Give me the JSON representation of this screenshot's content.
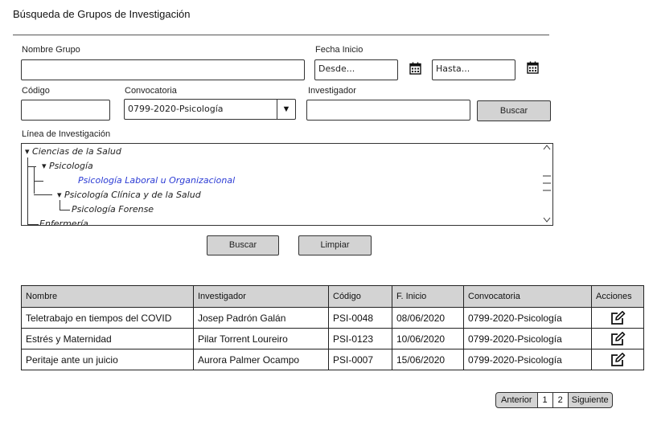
{
  "page_title": "Búsqueda de Grupos de Investigación",
  "filters": {
    "nombre_grupo_label": "Nombre Grupo",
    "nombre_grupo_value": "",
    "fecha_inicio_label": "Fecha Inicio",
    "desde_placeholder": "Desde...",
    "hasta_placeholder": "Hasta...",
    "codigo_label": "Código",
    "codigo_value": "",
    "convocatoria_label": "Convocatoria",
    "convocatoria_selected": "0799-2020-Psicología",
    "investigador_label": "Investigador",
    "investigador_value": "",
    "buscar_inline": "Buscar",
    "linea_label": "Línea de Investigación"
  },
  "tree": {
    "nodes": [
      {
        "label": "Ciencias de la Salud",
        "expanded": true
      },
      {
        "label": "Psicología",
        "expanded": true
      },
      {
        "label": "Psicología Laboral u Organizacional",
        "selected": true
      },
      {
        "label": "Psicología Clínica y de la Salud",
        "expanded": true
      },
      {
        "label": "Psicología Forense"
      },
      {
        "label": "Enfermería"
      }
    ]
  },
  "actions": {
    "buscar": "Buscar",
    "limpiar": "Limpiar"
  },
  "results": {
    "columns": [
      "Nombre",
      "Investigador",
      "Código",
      "F. Inicio",
      "Convocatoria",
      "Acciones"
    ],
    "rows": [
      [
        "Teletrabajo en tiempos del COVID",
        "Josep Padrón Galán",
        "PSI-0048",
        "08/06/2020",
        "0799-2020-Psicología"
      ],
      [
        "Estrés y Maternidad",
        "Pilar Torrent Loureiro",
        "PSI-0123",
        "10/06/2020",
        "0799-2020-Psicología"
      ],
      [
        "Peritaje ante un juicio",
        "Aurora Palmer Ocampo",
        "PSI-0007",
        "15/06/2020",
        "0799-2020-Psicología"
      ]
    ],
    "row_action_icon": "edit-icon"
  },
  "pagination": {
    "prev": "Anterior",
    "pages": [
      "1",
      "2"
    ],
    "next": "Siguiente"
  },
  "icons": {
    "calendar": "calendar-icon",
    "dropdown": "chevron-down-icon"
  }
}
